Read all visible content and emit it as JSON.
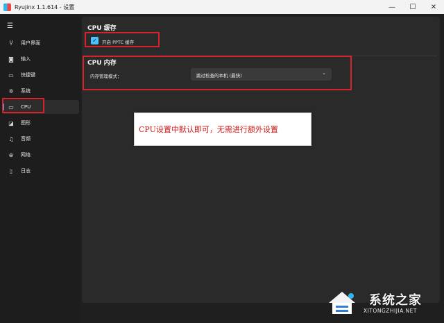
{
  "window": {
    "title": "Ryujinx 1.1.614 - 设置",
    "controls": {
      "minimize": "—",
      "maximize": "☐",
      "close": "✕"
    }
  },
  "sidebar": {
    "menu_icon": "☰",
    "items": [
      {
        "label": "用户界面",
        "icon": "ui-icon",
        "glyph": "Ⴤ"
      },
      {
        "label": "输入",
        "icon": "gamepad-icon",
        "glyph": "◙"
      },
      {
        "label": "快捷键",
        "icon": "keyboard-icon",
        "glyph": "▭"
      },
      {
        "label": "系统",
        "icon": "gear-icon",
        "glyph": "✲"
      },
      {
        "label": "CPU",
        "icon": "cpu-icon",
        "glyph": "▭"
      },
      {
        "label": "图形",
        "icon": "graphics-icon",
        "glyph": "◪"
      },
      {
        "label": "音频",
        "icon": "music-icon",
        "glyph": "♫"
      },
      {
        "label": "网络",
        "icon": "network-icon",
        "glyph": "⊕"
      },
      {
        "label": "日志",
        "icon": "log-icon",
        "glyph": "▯"
      }
    ],
    "active_index": 4
  },
  "cpu_cache": {
    "title": "CPU 缓存",
    "pptc_label": "开启 PPTC 缓存",
    "pptc_checked": true,
    "check_glyph": "✓"
  },
  "cpu_memory": {
    "title": "CPU 内存",
    "mode_label": "内存管理模式：",
    "mode_value": "跳过检查的本机 (最快)",
    "chevron": "⌄"
  },
  "annotation": {
    "note": "CPU设置中默认即可，无需进行额外设置"
  },
  "watermark": {
    "brand": "系统之家",
    "url": "XITONGZHIJIA.NET"
  },
  "colors": {
    "accent": "#4cc2ff",
    "annotation_red": "#d6232e",
    "note_text": "#d11a1a"
  }
}
